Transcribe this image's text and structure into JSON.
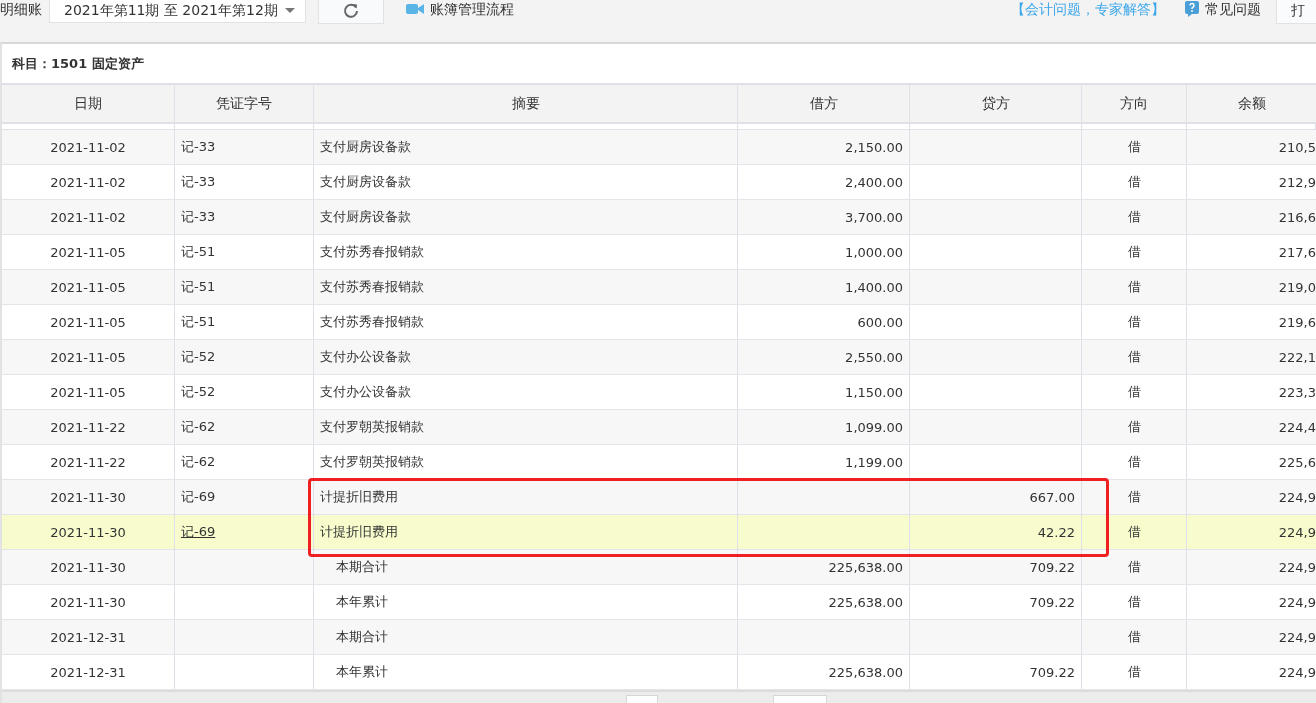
{
  "toolbar": {
    "title": "明细账",
    "period": "2021年第11期 至 2021年第12期",
    "flow_link": "账簿管理流程",
    "expert_link": "【会计问题，专家解答】",
    "faq_link": "常见问题",
    "print_button": "打"
  },
  "subject": {
    "label": "科目：",
    "value": "1501 固定资产"
  },
  "table": {
    "columns": [
      "日期",
      "凭证字号",
      "摘要",
      "借方",
      "贷方",
      "方向",
      "余额"
    ],
    "rows": [
      {
        "kind": "entry",
        "selected": false,
        "cells": [
          "2021-11-02",
          "记-33",
          "支付厨房设备款",
          "2,150.00",
          "",
          "借",
          "210,5"
        ]
      },
      {
        "kind": "entry",
        "selected": false,
        "cells": [
          "2021-11-02",
          "记-33",
          "支付厨房设备款",
          "2,400.00",
          "",
          "借",
          "212,9"
        ]
      },
      {
        "kind": "entry",
        "selected": false,
        "cells": [
          "2021-11-02",
          "记-33",
          "支付厨房设备款",
          "3,700.00",
          "",
          "借",
          "216,6"
        ]
      },
      {
        "kind": "entry",
        "selected": false,
        "cells": [
          "2021-11-05",
          "记-51",
          "支付苏秀春报销款",
          "1,000.00",
          "",
          "借",
          "217,6"
        ]
      },
      {
        "kind": "entry",
        "selected": false,
        "cells": [
          "2021-11-05",
          "记-51",
          "支付苏秀春报销款",
          "1,400.00",
          "",
          "借",
          "219,0"
        ]
      },
      {
        "kind": "entry",
        "selected": false,
        "cells": [
          "2021-11-05",
          "记-51",
          "支付苏秀春报销款",
          "600.00",
          "",
          "借",
          "219,6"
        ]
      },
      {
        "kind": "entry",
        "selected": false,
        "cells": [
          "2021-11-05",
          "记-52",
          "支付办公设备款",
          "2,550.00",
          "",
          "借",
          "222,1"
        ]
      },
      {
        "kind": "entry",
        "selected": false,
        "cells": [
          "2021-11-05",
          "记-52",
          "支付办公设备款",
          "1,150.00",
          "",
          "借",
          "223,3"
        ]
      },
      {
        "kind": "entry",
        "selected": false,
        "cells": [
          "2021-11-22",
          "记-62",
          "支付罗朝英报销款",
          "1,099.00",
          "",
          "借",
          "224,4"
        ]
      },
      {
        "kind": "entry",
        "selected": false,
        "cells": [
          "2021-11-22",
          "记-62",
          "支付罗朝英报销款",
          "1,199.00",
          "",
          "借",
          "225,6"
        ]
      },
      {
        "kind": "entry",
        "selected": false,
        "cells": [
          "2021-11-30",
          "记-69",
          "计提折旧费用",
          "",
          "667.00",
          "借",
          "224,9"
        ]
      },
      {
        "kind": "entry",
        "selected": true,
        "cells": [
          "2021-11-30",
          "记-69",
          "计提折旧费用",
          "",
          "42.22",
          "借",
          "224,9"
        ]
      },
      {
        "kind": "total",
        "selected": false,
        "cells": [
          "2021-11-30",
          "",
          "本期合计",
          "225,638.00",
          "709.22",
          "借",
          "224,9"
        ]
      },
      {
        "kind": "total",
        "selected": false,
        "cells": [
          "2021-11-30",
          "",
          "本年累计",
          "225,638.00",
          "709.22",
          "借",
          "224,9"
        ]
      },
      {
        "kind": "total",
        "selected": false,
        "cells": [
          "2021-12-31",
          "",
          "本期合计",
          "",
          "",
          "借",
          "224,9"
        ]
      },
      {
        "kind": "total",
        "selected": false,
        "cells": [
          "2021-12-31",
          "",
          "本年累计",
          "225,638.00",
          "709.22",
          "借",
          "224,9"
        ]
      }
    ]
  }
}
